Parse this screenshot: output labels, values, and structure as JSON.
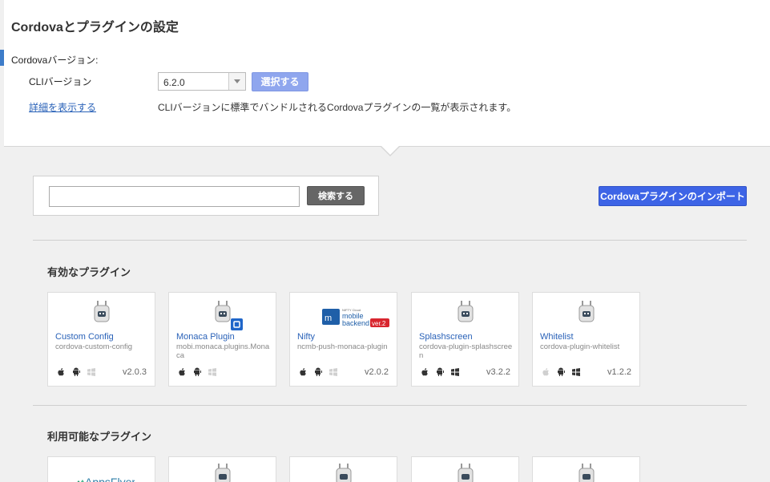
{
  "header": {
    "title": "Cordovaとプラグインの設定",
    "section_label": "Cordovaバージョン:",
    "cli_label": "CLIバージョン",
    "cli_version": "6.2.0",
    "select_button": "選択する",
    "detail_link": "詳細を表示する",
    "description": "CLIバージョンに標準でバンドルされるCordovaプラグインの一覧が表示されます。"
  },
  "search": {
    "input_value": "",
    "button_label": "検索する"
  },
  "import_button": "Cordovaプラグインのインポート",
  "enabled_section": {
    "title": "有効なプラグイン",
    "plugins": [
      {
        "name": "Custom Config",
        "package": "cordova-custom-config",
        "version": "v2.0.3",
        "ios": true,
        "android": true,
        "windows": false
      },
      {
        "name": "Monaca Plugin",
        "package": "mobi.monaca.plugins.Monaca",
        "version": "",
        "ios": true,
        "android": true,
        "windows": false
      },
      {
        "name": "Nifty",
        "package": "ncmb-push-monaca-plugin",
        "version": "v2.0.2",
        "ios": true,
        "android": true,
        "windows": false
      },
      {
        "name": "Splashscreen",
        "package": "cordova-plugin-splashscreen",
        "version": "v3.2.2",
        "ios": true,
        "android": true,
        "windows": true
      },
      {
        "name": "Whitelist",
        "package": "cordova-plugin-whitelist",
        "version": "v1.2.2",
        "ios": false,
        "android": true,
        "windows": true
      }
    ]
  },
  "available_section": {
    "title": "利用可能なプラグイン",
    "first_logo_text": "AppsFlyer"
  },
  "nifty_logo": {
    "small": "NIFTY Cloud",
    "line1": "mobile",
    "line2": "backend",
    "badge": "ver.2"
  },
  "colors": {
    "accent": "#3d64e6",
    "link": "#2a62b8",
    "select_button": "#8fa6ee"
  }
}
